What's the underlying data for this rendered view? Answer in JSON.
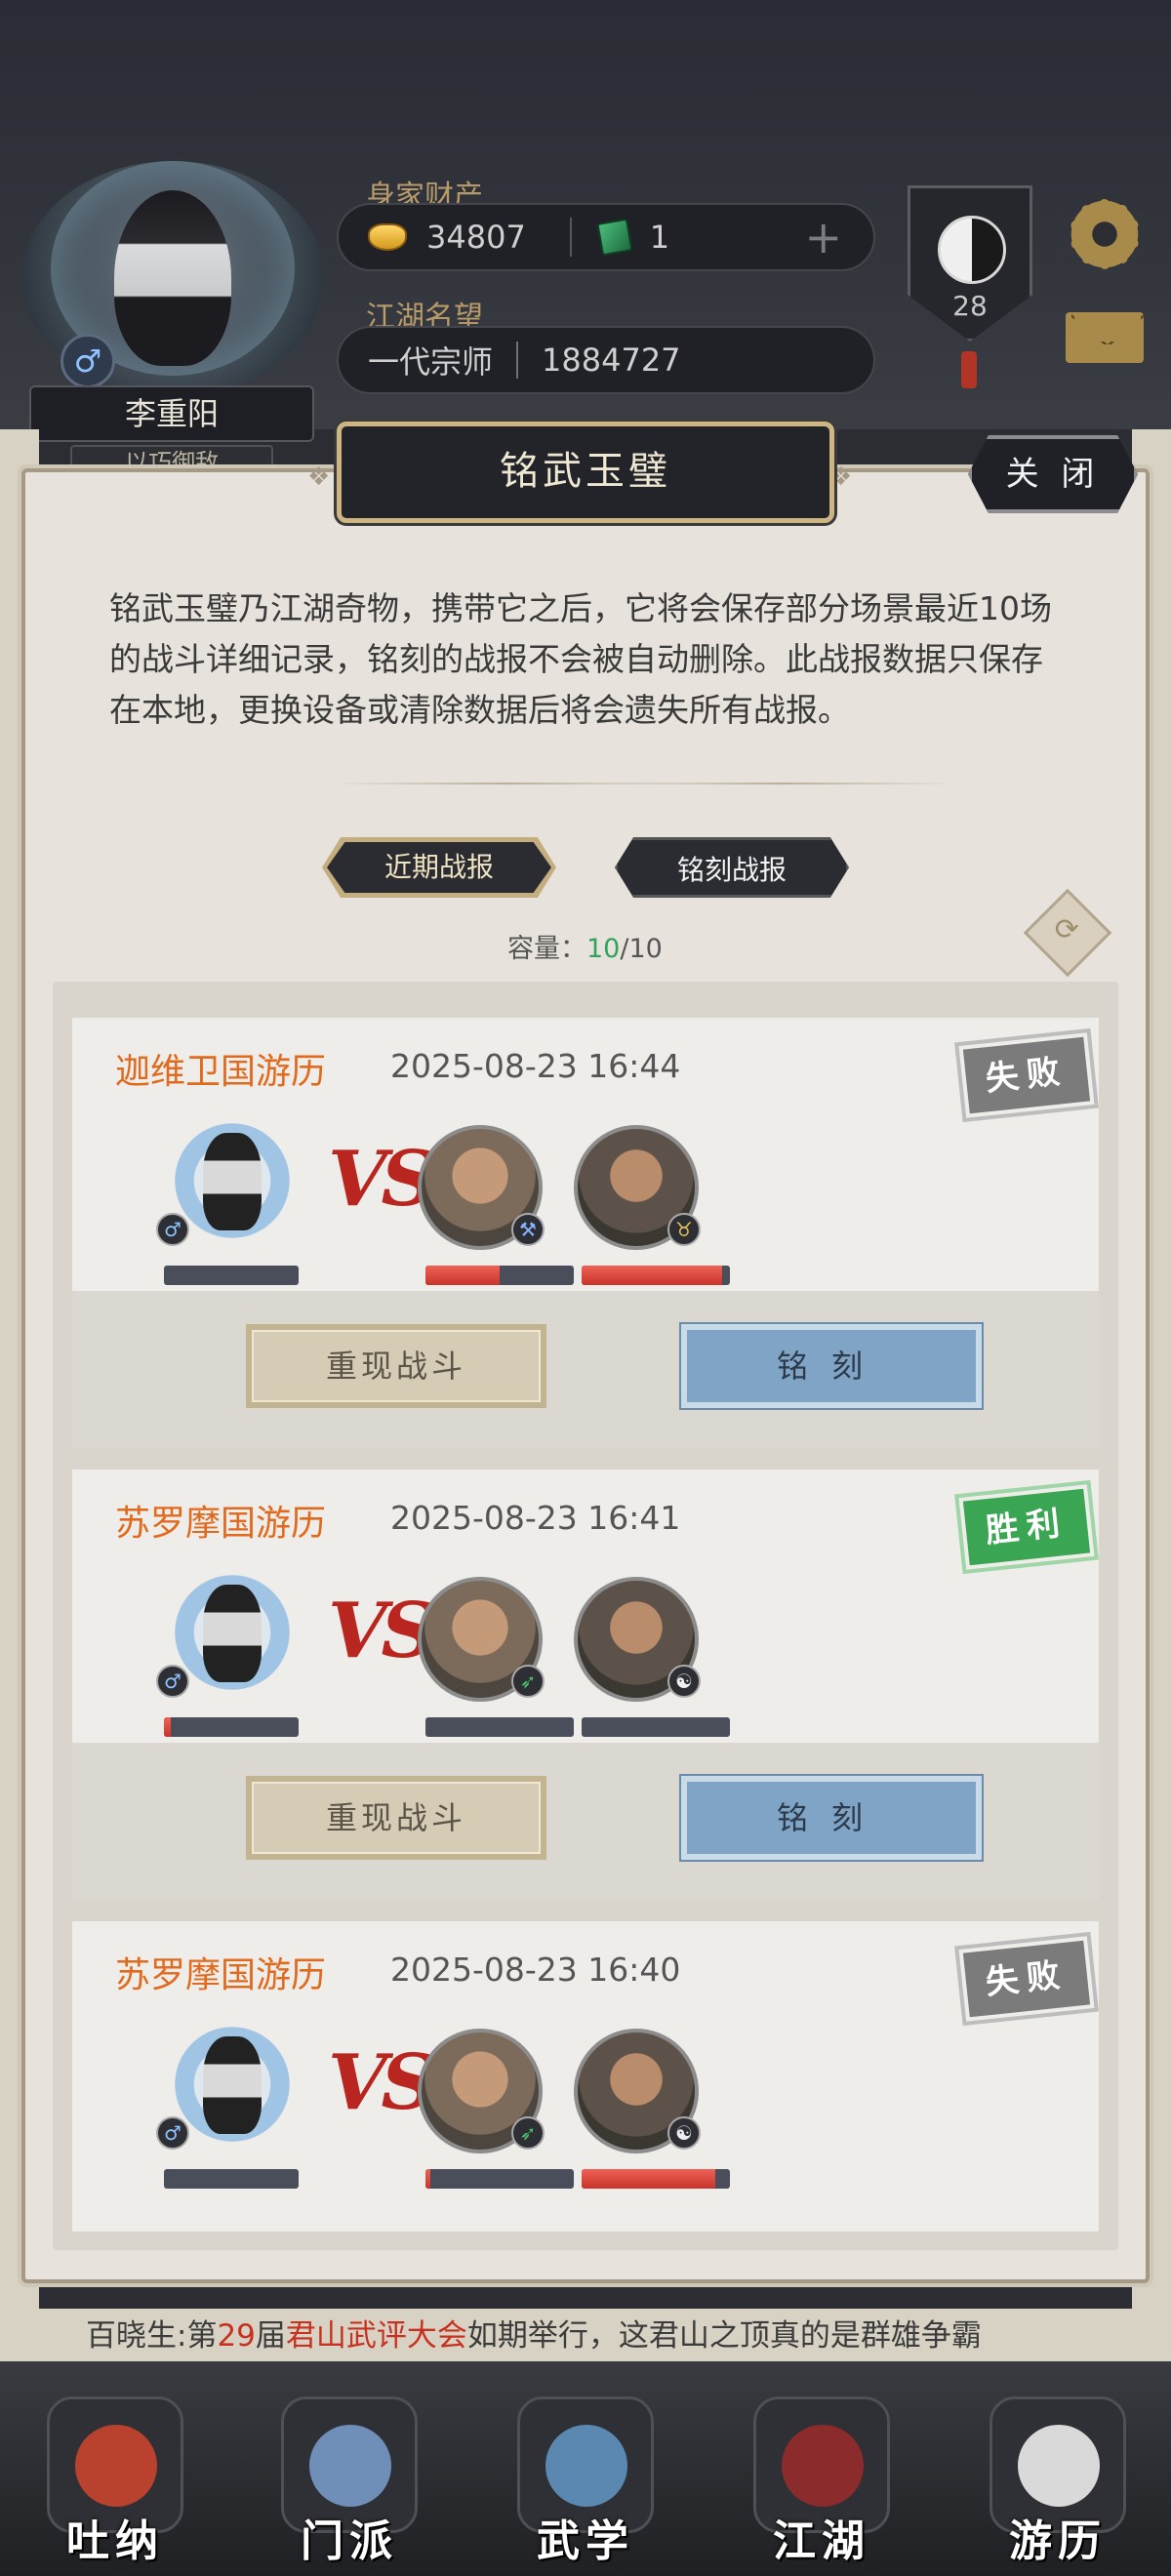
{
  "player": {
    "name": "李重阳",
    "title_partial": "以巧御敌",
    "gender_symbol": "♂",
    "wealth_label": "身家财产",
    "gold": "34807",
    "jade": "1",
    "fame_label": "江湖名望",
    "rank": "一代宗师",
    "fame": "1884727",
    "level": "28"
  },
  "modal": {
    "title": "铭武玉璧",
    "close_label": "关 闭",
    "description": "铭武玉璧乃江湖奇物，携带它之后，它将会保存部分场景最近10场的战斗详细记录，铭刻的战报不会被自动删除。此战报数据只保存在本地，更换设备或清除数据后将会遗失所有战报。",
    "tabs": [
      "近期战报",
      "铭刻战报"
    ],
    "capacity_label": "容量：",
    "capacity_current": "10",
    "capacity_total": "/10"
  },
  "battles": [
    {
      "location": "迦维卫国游历",
      "time": "2025-08-23 16:44",
      "result": "失败",
      "result_type": "lose",
      "player_hp": 0.0,
      "enemy_hp": [
        0.5,
        0.95
      ],
      "enemy_badges": [
        "⚒",
        "♉"
      ],
      "replay_label": "重现战斗",
      "engrave_label": "铭刻"
    },
    {
      "location": "苏罗摩国游历",
      "time": "2025-08-23 16:41",
      "result": "胜利",
      "result_type": "win",
      "player_hp": 0.05,
      "enemy_hp": [
        0.0,
        0.0
      ],
      "enemy_badges": [
        "➶",
        "☯"
      ],
      "replay_label": "重现战斗",
      "engrave_label": "铭刻"
    },
    {
      "location": "苏罗摩国游历",
      "time": "2025-08-23 16:40",
      "result": "失败",
      "result_type": "lose",
      "player_hp": 0.0,
      "enemy_hp": [
        0.03,
        0.9
      ],
      "enemy_badges": [
        "➶",
        "☯"
      ]
    }
  ],
  "ticker": {
    "prefix": "百晓生:第",
    "num": "29",
    "mid": "届",
    "event": "君山武评大会",
    "suffix": "如期举行，这君山之顶真的是群雄争霸"
  },
  "nav": [
    {
      "label": "吐纳",
      "color": "#b8422e"
    },
    {
      "label": "门派",
      "color": "#6f8fb8"
    },
    {
      "label": "武学",
      "color": "#5a88b0"
    },
    {
      "label": "江湖",
      "color": "#8b2b2b"
    },
    {
      "label": "游历",
      "color": "#d9d9d9"
    }
  ],
  "colors": {
    "accent_orange": "#e06a1e",
    "win_green": "#3aa653",
    "lose_gray": "#7b7b7b",
    "vs_red": "#b8261f"
  }
}
